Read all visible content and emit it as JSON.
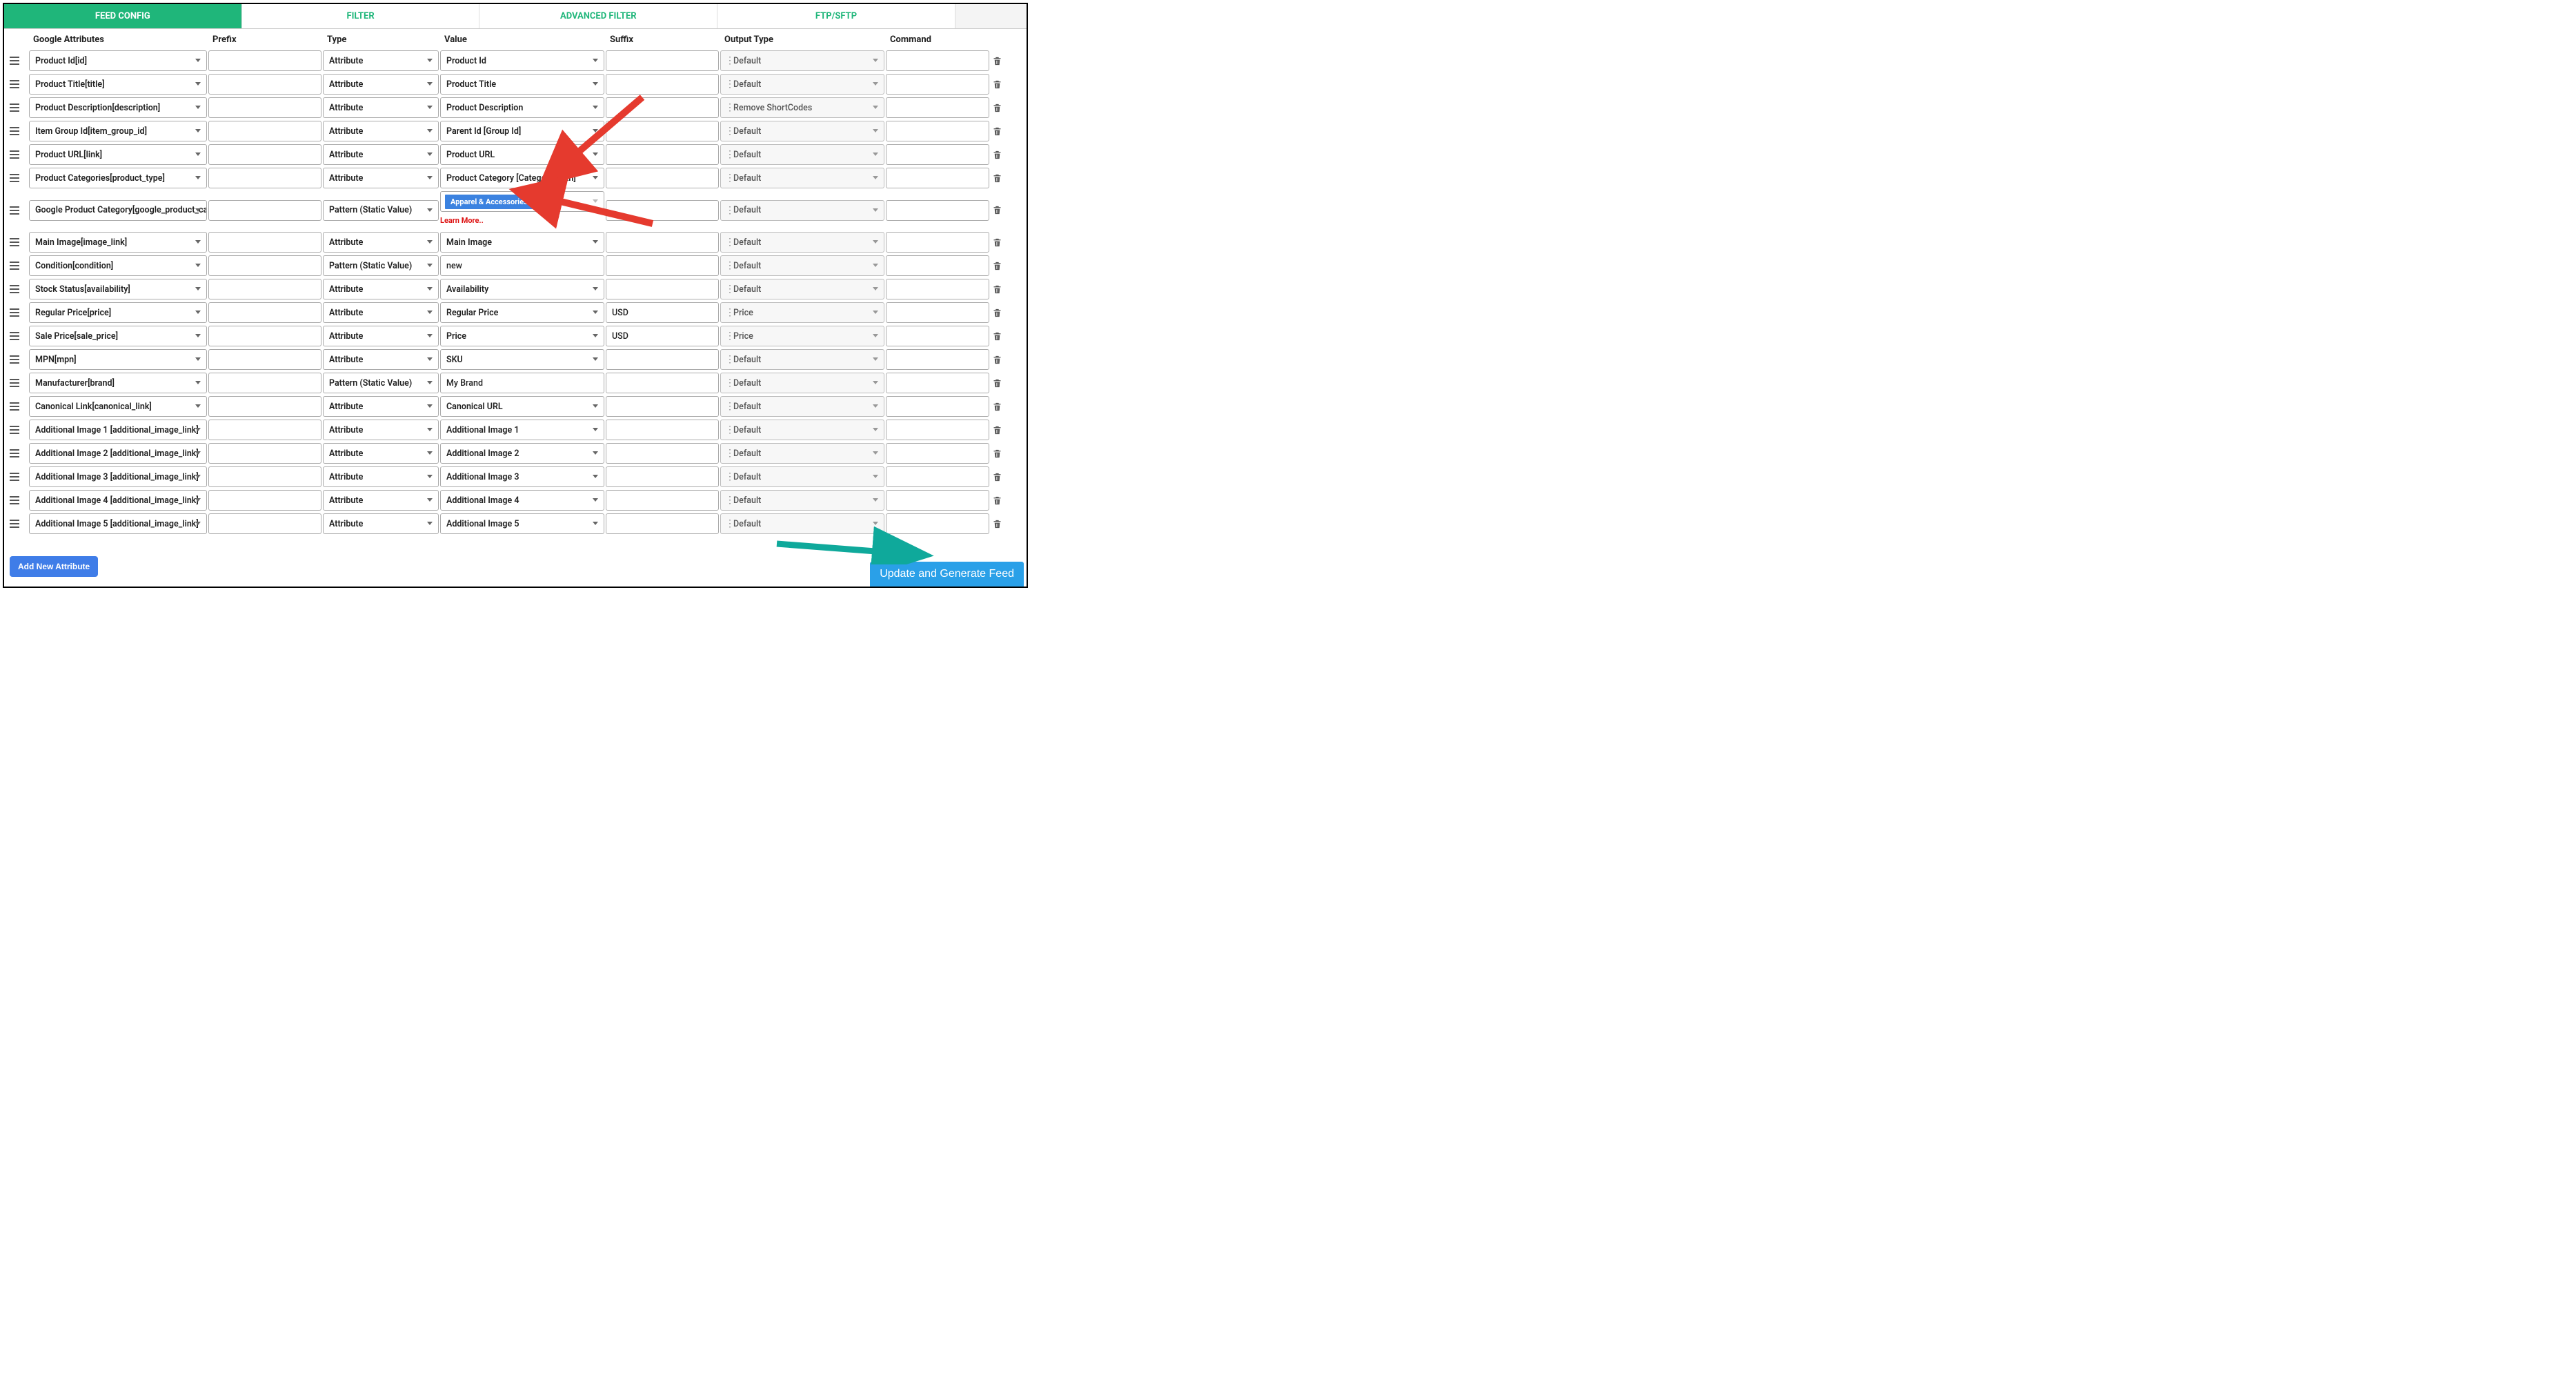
{
  "tabs": [
    "FEED CONFIG",
    "FILTER",
    "ADVANCED FILTER",
    "FTP/SFTP",
    ""
  ],
  "activeTab": 0,
  "headers": {
    "attr": "Google Attributes",
    "prefix": "Prefix",
    "type": "Type",
    "value": "Value",
    "suffix": "Suffix",
    "output": "Output Type",
    "command": "Command"
  },
  "rows": [
    {
      "attr": "Product Id[id]",
      "prefix": "",
      "type": "Attribute",
      "valueKind": "sel",
      "value": "Product Id",
      "suffix": "",
      "output": "Default",
      "command": ""
    },
    {
      "attr": "Product Title[title]",
      "prefix": "",
      "type": "Attribute",
      "valueKind": "sel",
      "value": "Product Title",
      "suffix": "",
      "output": "Default",
      "command": ""
    },
    {
      "attr": "Product Description[description]",
      "prefix": "",
      "type": "Attribute",
      "valueKind": "sel",
      "value": "Product Description",
      "suffix": "",
      "output": "Remove ShortCodes",
      "command": ""
    },
    {
      "attr": "Item Group Id[item_group_id]",
      "prefix": "",
      "type": "Attribute",
      "valueKind": "sel",
      "value": "Parent Id [Group Id]",
      "suffix": "",
      "output": "Default",
      "command": ""
    },
    {
      "attr": "Product URL[link]",
      "prefix": "",
      "type": "Attribute",
      "valueKind": "sel",
      "value": "Product URL",
      "suffix": "",
      "output": "Default",
      "command": ""
    },
    {
      "attr": "Product Categories[product_type]",
      "prefix": "",
      "type": "Attribute",
      "valueKind": "sel",
      "value": "Product Category [Category Path]",
      "suffix": "",
      "output": "Default",
      "command": ""
    },
    {
      "attr": "Google Product Category[google_product_cat",
      "prefix": "",
      "type": "Pattern (Static Value)",
      "valueKind": "token",
      "value": "Apparel & Accessories",
      "suffix": "",
      "output": "Default",
      "command": "",
      "learnMore": "Learn More.."
    },
    {
      "attr": "Main Image[image_link]",
      "prefix": "",
      "type": "Attribute",
      "valueKind": "sel",
      "value": "Main Image",
      "suffix": "",
      "output": "Default",
      "command": ""
    },
    {
      "attr": "Condition[condition]",
      "prefix": "",
      "type": "Pattern (Static Value)",
      "valueKind": "inp",
      "value": "new",
      "suffix": "",
      "output": "Default",
      "command": ""
    },
    {
      "attr": "Stock Status[availability]",
      "prefix": "",
      "type": "Attribute",
      "valueKind": "sel",
      "value": "Availability",
      "suffix": "",
      "output": "Default",
      "command": ""
    },
    {
      "attr": "Regular Price[price]",
      "prefix": "",
      "type": "Attribute",
      "valueKind": "sel",
      "value": "Regular Price",
      "suffix": "USD",
      "output": "Price",
      "command": ""
    },
    {
      "attr": "Sale Price[sale_price]",
      "prefix": "",
      "type": "Attribute",
      "valueKind": "sel",
      "value": "Price",
      "suffix": "USD",
      "output": "Price",
      "command": ""
    },
    {
      "attr": "MPN[mpn]",
      "prefix": "",
      "type": "Attribute",
      "valueKind": "sel",
      "value": "SKU",
      "suffix": "",
      "output": "Default",
      "command": ""
    },
    {
      "attr": "Manufacturer[brand]",
      "prefix": "",
      "type": "Pattern (Static Value)",
      "valueKind": "inp",
      "value": "My Brand",
      "suffix": "",
      "output": "Default",
      "command": ""
    },
    {
      "attr": "Canonical Link[canonical_link]",
      "prefix": "",
      "type": "Attribute",
      "valueKind": "sel",
      "value": "Canonical URL",
      "suffix": "",
      "output": "Default",
      "command": ""
    },
    {
      "attr": "Additional Image 1 [additional_image_link]",
      "prefix": "",
      "type": "Attribute",
      "valueKind": "sel",
      "value": "Additional Image 1",
      "suffix": "",
      "output": "Default",
      "command": ""
    },
    {
      "attr": "Additional Image 2 [additional_image_link]",
      "prefix": "",
      "type": "Attribute",
      "valueKind": "sel",
      "value": "Additional Image 2",
      "suffix": "",
      "output": "Default",
      "command": ""
    },
    {
      "attr": "Additional Image 3 [additional_image_link]",
      "prefix": "",
      "type": "Attribute",
      "valueKind": "sel",
      "value": "Additional Image 3",
      "suffix": "",
      "output": "Default",
      "command": ""
    },
    {
      "attr": "Additional Image 4 [additional_image_link]",
      "prefix": "",
      "type": "Attribute",
      "valueKind": "sel",
      "value": "Additional Image 4",
      "suffix": "",
      "output": "Default",
      "command": ""
    },
    {
      "attr": "Additional Image 5 [additional_image_link]",
      "prefix": "",
      "type": "Attribute",
      "valueKind": "sel",
      "value": "Additional Image 5",
      "suffix": "",
      "output": "Default",
      "command": ""
    }
  ],
  "buttons": {
    "add": "Add New Attribute",
    "generate": "Update and Generate Feed"
  }
}
